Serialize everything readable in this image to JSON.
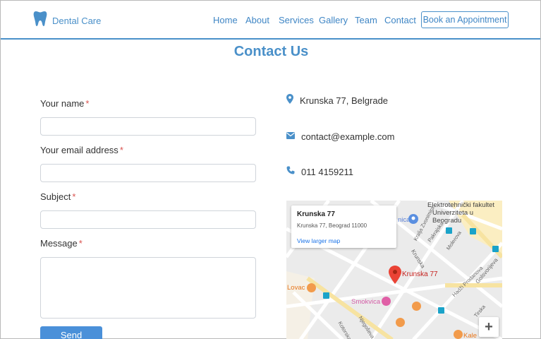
{
  "brand": {
    "name": "Dental Care",
    "color": "#4a90c9"
  },
  "nav": {
    "links": [
      "Home",
      "About",
      "Services",
      "Gallery",
      "Team",
      "Contact"
    ],
    "book_button": "Book an Appointment"
  },
  "page": {
    "title": "Contact Us"
  },
  "form": {
    "required_mark": "*",
    "fields": {
      "name": {
        "label": "Your name",
        "value": ""
      },
      "email": {
        "label": "Your email address",
        "value": ""
      },
      "subject": {
        "label": "Subject",
        "value": ""
      },
      "message": {
        "label": "Message",
        "value": ""
      }
    },
    "submit_label": "Send"
  },
  "contact": {
    "address": "Krunska 77, Belgrade",
    "email": "contact@example.com",
    "phone": "011 4159211"
  },
  "map": {
    "card_title": "Krunska 77",
    "card_address": "Krunska 77, Beograd 11000",
    "card_link": "View larger map",
    "marker_label": "Krunska 77",
    "poi_top": "Elektrotehnički fakultet",
    "poi_top_2": "Univerziteta u Beogradu",
    "poi_smokvica": "Smokvica",
    "poi_lovac": "Lovac",
    "poi_kale": "Kale",
    "poi_nica": "nica",
    "streets": [
      "Krunska",
      "Kralja Zvonimira",
      "Pakrajska",
      "Molerova",
      "Hadži Prodanova",
      "Golsvorijeva",
      "Njegoševa",
      "Kotorska",
      "Tirska"
    ],
    "zoom_in": "+"
  },
  "colors": {
    "accent": "#4a90c9",
    "button": "#4a90d9",
    "required": "#d9534f"
  }
}
